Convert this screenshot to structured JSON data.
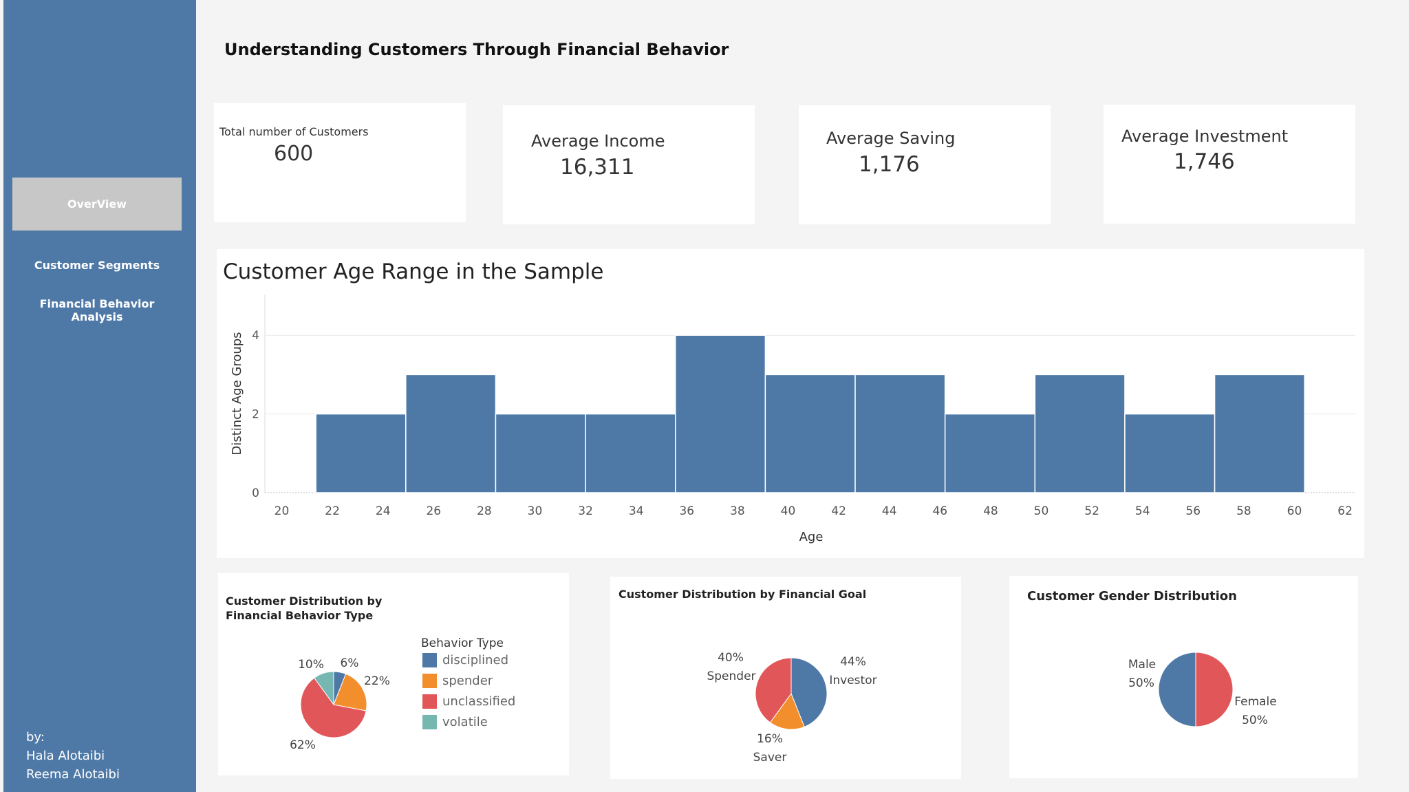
{
  "dashboard": {
    "title": "Understanding Customers Through Financial Behavior"
  },
  "sidebar": {
    "items": [
      {
        "label": "OverView",
        "active": true
      },
      {
        "label": "Customer Segments",
        "active": false
      },
      {
        "label": "Financial Behavior Analysis",
        "active": false
      }
    ],
    "credits": {
      "by": "by:",
      "authors": [
        "Hala Alotaibi",
        "Reema Alotaibi"
      ]
    }
  },
  "kpis": [
    {
      "label": "Total number of Customers",
      "value": "600"
    },
    {
      "label": "Average Income",
      "value": "16,311"
    },
    {
      "label": "Average Saving",
      "value": "1,176"
    },
    {
      "label": "Average Investment",
      "value": "1,746"
    }
  ],
  "colors": {
    "sidebar": "#4e79a7",
    "bar": "#4e79a7",
    "blue": "#4e79a7",
    "orange": "#f28e2b",
    "red": "#e15759",
    "teal": "#76b7b2"
  },
  "chart_data": [
    {
      "type": "bar",
      "title": "Customer Age Range in the Sample",
      "xlabel": "Age",
      "ylabel": "Distinct Age Groups",
      "xlim": [
        20,
        62
      ],
      "ylim": [
        0,
        4
      ],
      "x_ticks": [
        "20",
        "22",
        "24",
        "26",
        "28",
        "30",
        "32",
        "34",
        "36",
        "38",
        "40",
        "42",
        "44",
        "46",
        "48",
        "50",
        "52",
        "54",
        "56",
        "58",
        "60",
        "62"
      ],
      "y_ticks": [
        "0",
        "2",
        "4"
      ],
      "bins": [
        {
          "from": 21.35,
          "to": 24.9,
          "value": 2
        },
        {
          "from": 24.9,
          "to": 28.45,
          "value": 3
        },
        {
          "from": 28.45,
          "to": 32.0,
          "value": 2
        },
        {
          "from": 32.0,
          "to": 35.55,
          "value": 2
        },
        {
          "from": 35.55,
          "to": 39.1,
          "value": 4
        },
        {
          "from": 39.1,
          "to": 42.65,
          "value": 3
        },
        {
          "from": 42.65,
          "to": 46.2,
          "value": 3
        },
        {
          "from": 46.2,
          "to": 49.75,
          "value": 2
        },
        {
          "from": 49.75,
          "to": 53.3,
          "value": 3
        },
        {
          "from": 53.3,
          "to": 56.85,
          "value": 2
        },
        {
          "from": 56.85,
          "to": 60.4,
          "value": 3
        }
      ],
      "grid": true
    },
    {
      "type": "pie",
      "title": "Customer Distribution by Financial Behavior Type",
      "title_lines": [
        "Customer Distribution by",
        "Financial Behavior Type"
      ],
      "legend_title": "Behavior Type",
      "slices": [
        {
          "name": "disciplined",
          "value": 6,
          "label": "6%",
          "color": "#4e79a7"
        },
        {
          "name": "spender",
          "value": 22,
          "label": "22%",
          "color": "#f28e2b"
        },
        {
          "name": "unclassified",
          "value": 62,
          "label": "62%",
          "color": "#e15759"
        },
        {
          "name": "volatile",
          "value": 10,
          "label": "10%",
          "color": "#76b7b2"
        }
      ]
    },
    {
      "type": "pie",
      "title": "Customer Distribution by Financial Goal",
      "slices": [
        {
          "name": "Investor",
          "value": 44,
          "label": "44%",
          "color": "#4e79a7"
        },
        {
          "name": "Saver",
          "value": 16,
          "label": "16%",
          "color": "#f28e2b"
        },
        {
          "name": "Spender",
          "value": 40,
          "label": "40%",
          "color": "#e15759"
        }
      ]
    },
    {
      "type": "pie",
      "title": "Customer Gender Distribution",
      "slices": [
        {
          "name": "Female",
          "value": 50,
          "label": "50%",
          "color": "#e15759"
        },
        {
          "name": "Male",
          "value": 50,
          "label": "50%",
          "color": "#4e79a7"
        }
      ]
    }
  ]
}
